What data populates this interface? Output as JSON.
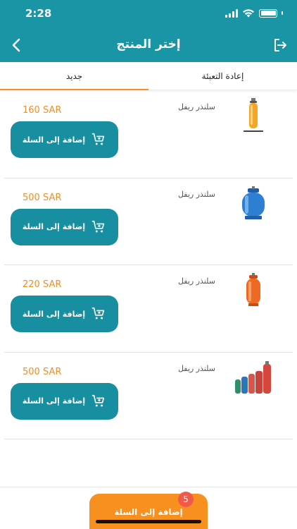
{
  "status": {
    "time": "2:28"
  },
  "nav": {
    "title": "إختر المنتج"
  },
  "tabs": {
    "new": "جديد",
    "refill": "إعادة التعبئة"
  },
  "products": [
    {
      "name": "سلنذر ريفل",
      "price": "160 SAR",
      "add_label": "إضافة إلى السلة",
      "image": "yellow-cylinder"
    },
    {
      "name": "سلنذر ريفل",
      "price": "500 SAR",
      "add_label": "إضافة إلى السلة",
      "image": "blue-cylinder"
    },
    {
      "name": "سلنذر ريفل",
      "price": "220 SAR",
      "add_label": "إضافة إلى السلة",
      "image": "orange-cylinder"
    },
    {
      "name": "سلنذر ريفل",
      "price": "500 SAR",
      "add_label": "إضافة إلى السلة",
      "image": "cylinder-group"
    }
  ],
  "cart": {
    "checkout_label": "إضافة إلى السلة",
    "count": "5"
  },
  "colors": {
    "primary": "#1a95a6",
    "accent": "#f7901f",
    "badge": "#f15a4a",
    "price": "#ef8f2b"
  }
}
